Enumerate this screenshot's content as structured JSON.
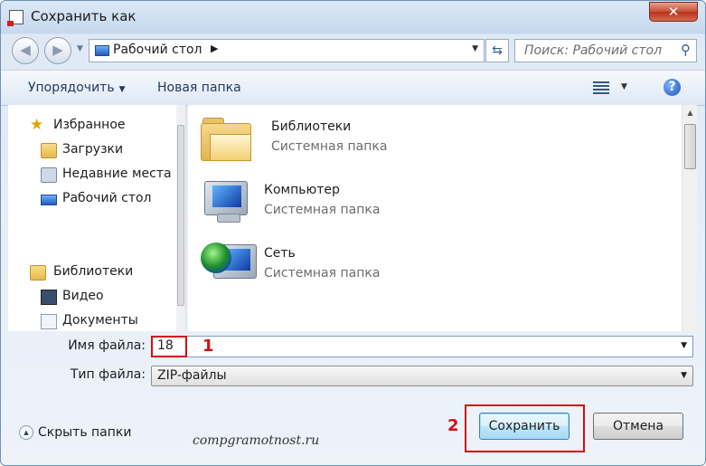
{
  "window": {
    "title": "Сохранить как",
    "close_glyph": "✕"
  },
  "navbar": {
    "back_glyph": "◀",
    "forward_glyph": "▶",
    "address": {
      "location": "Рабочий стол",
      "icon": "desktop-icon"
    },
    "search": {
      "placeholder": "Поиск: Рабочий стол",
      "icon": "magnifier-icon"
    }
  },
  "toolbar": {
    "organize_label": "Упорядочить",
    "new_folder_label": "Новая папка",
    "help_glyph": "?"
  },
  "sidebar": {
    "favorites": {
      "label": "Избранное",
      "items": [
        {
          "label": "Загрузки",
          "icon": "downloads-folder-icon"
        },
        {
          "label": "Недавние места",
          "icon": "recent-places-icon"
        },
        {
          "label": "Рабочий стол",
          "icon": "desktop-icon"
        }
      ]
    },
    "libraries": {
      "label": "Библиотеки",
      "items": [
        {
          "label": "Видео",
          "icon": "video-icon"
        },
        {
          "label": "Документы",
          "icon": "documents-icon"
        }
      ]
    }
  },
  "content": {
    "items": [
      {
        "name": "Библиотеки",
        "type": "Системная папка",
        "icon": "libraries-folder-icon"
      },
      {
        "name": "Компьютер",
        "type": "Системная папка",
        "icon": "computer-icon"
      },
      {
        "name": "Сеть",
        "type": "Системная папка",
        "icon": "network-icon"
      }
    ]
  },
  "form": {
    "filename_label": "Имя файла:",
    "filename_value": "18",
    "filetype_label": "Тип файла:",
    "filetype_value": "ZIP-файлы"
  },
  "annotations": {
    "marker_1": "1",
    "marker_2": "2",
    "color": "#d01010"
  },
  "footer": {
    "hide_folders_label": "Скрыть папки",
    "save_label": "Сохранить",
    "cancel_label": "Отмена",
    "watermark": "compgramotnost.ru"
  }
}
